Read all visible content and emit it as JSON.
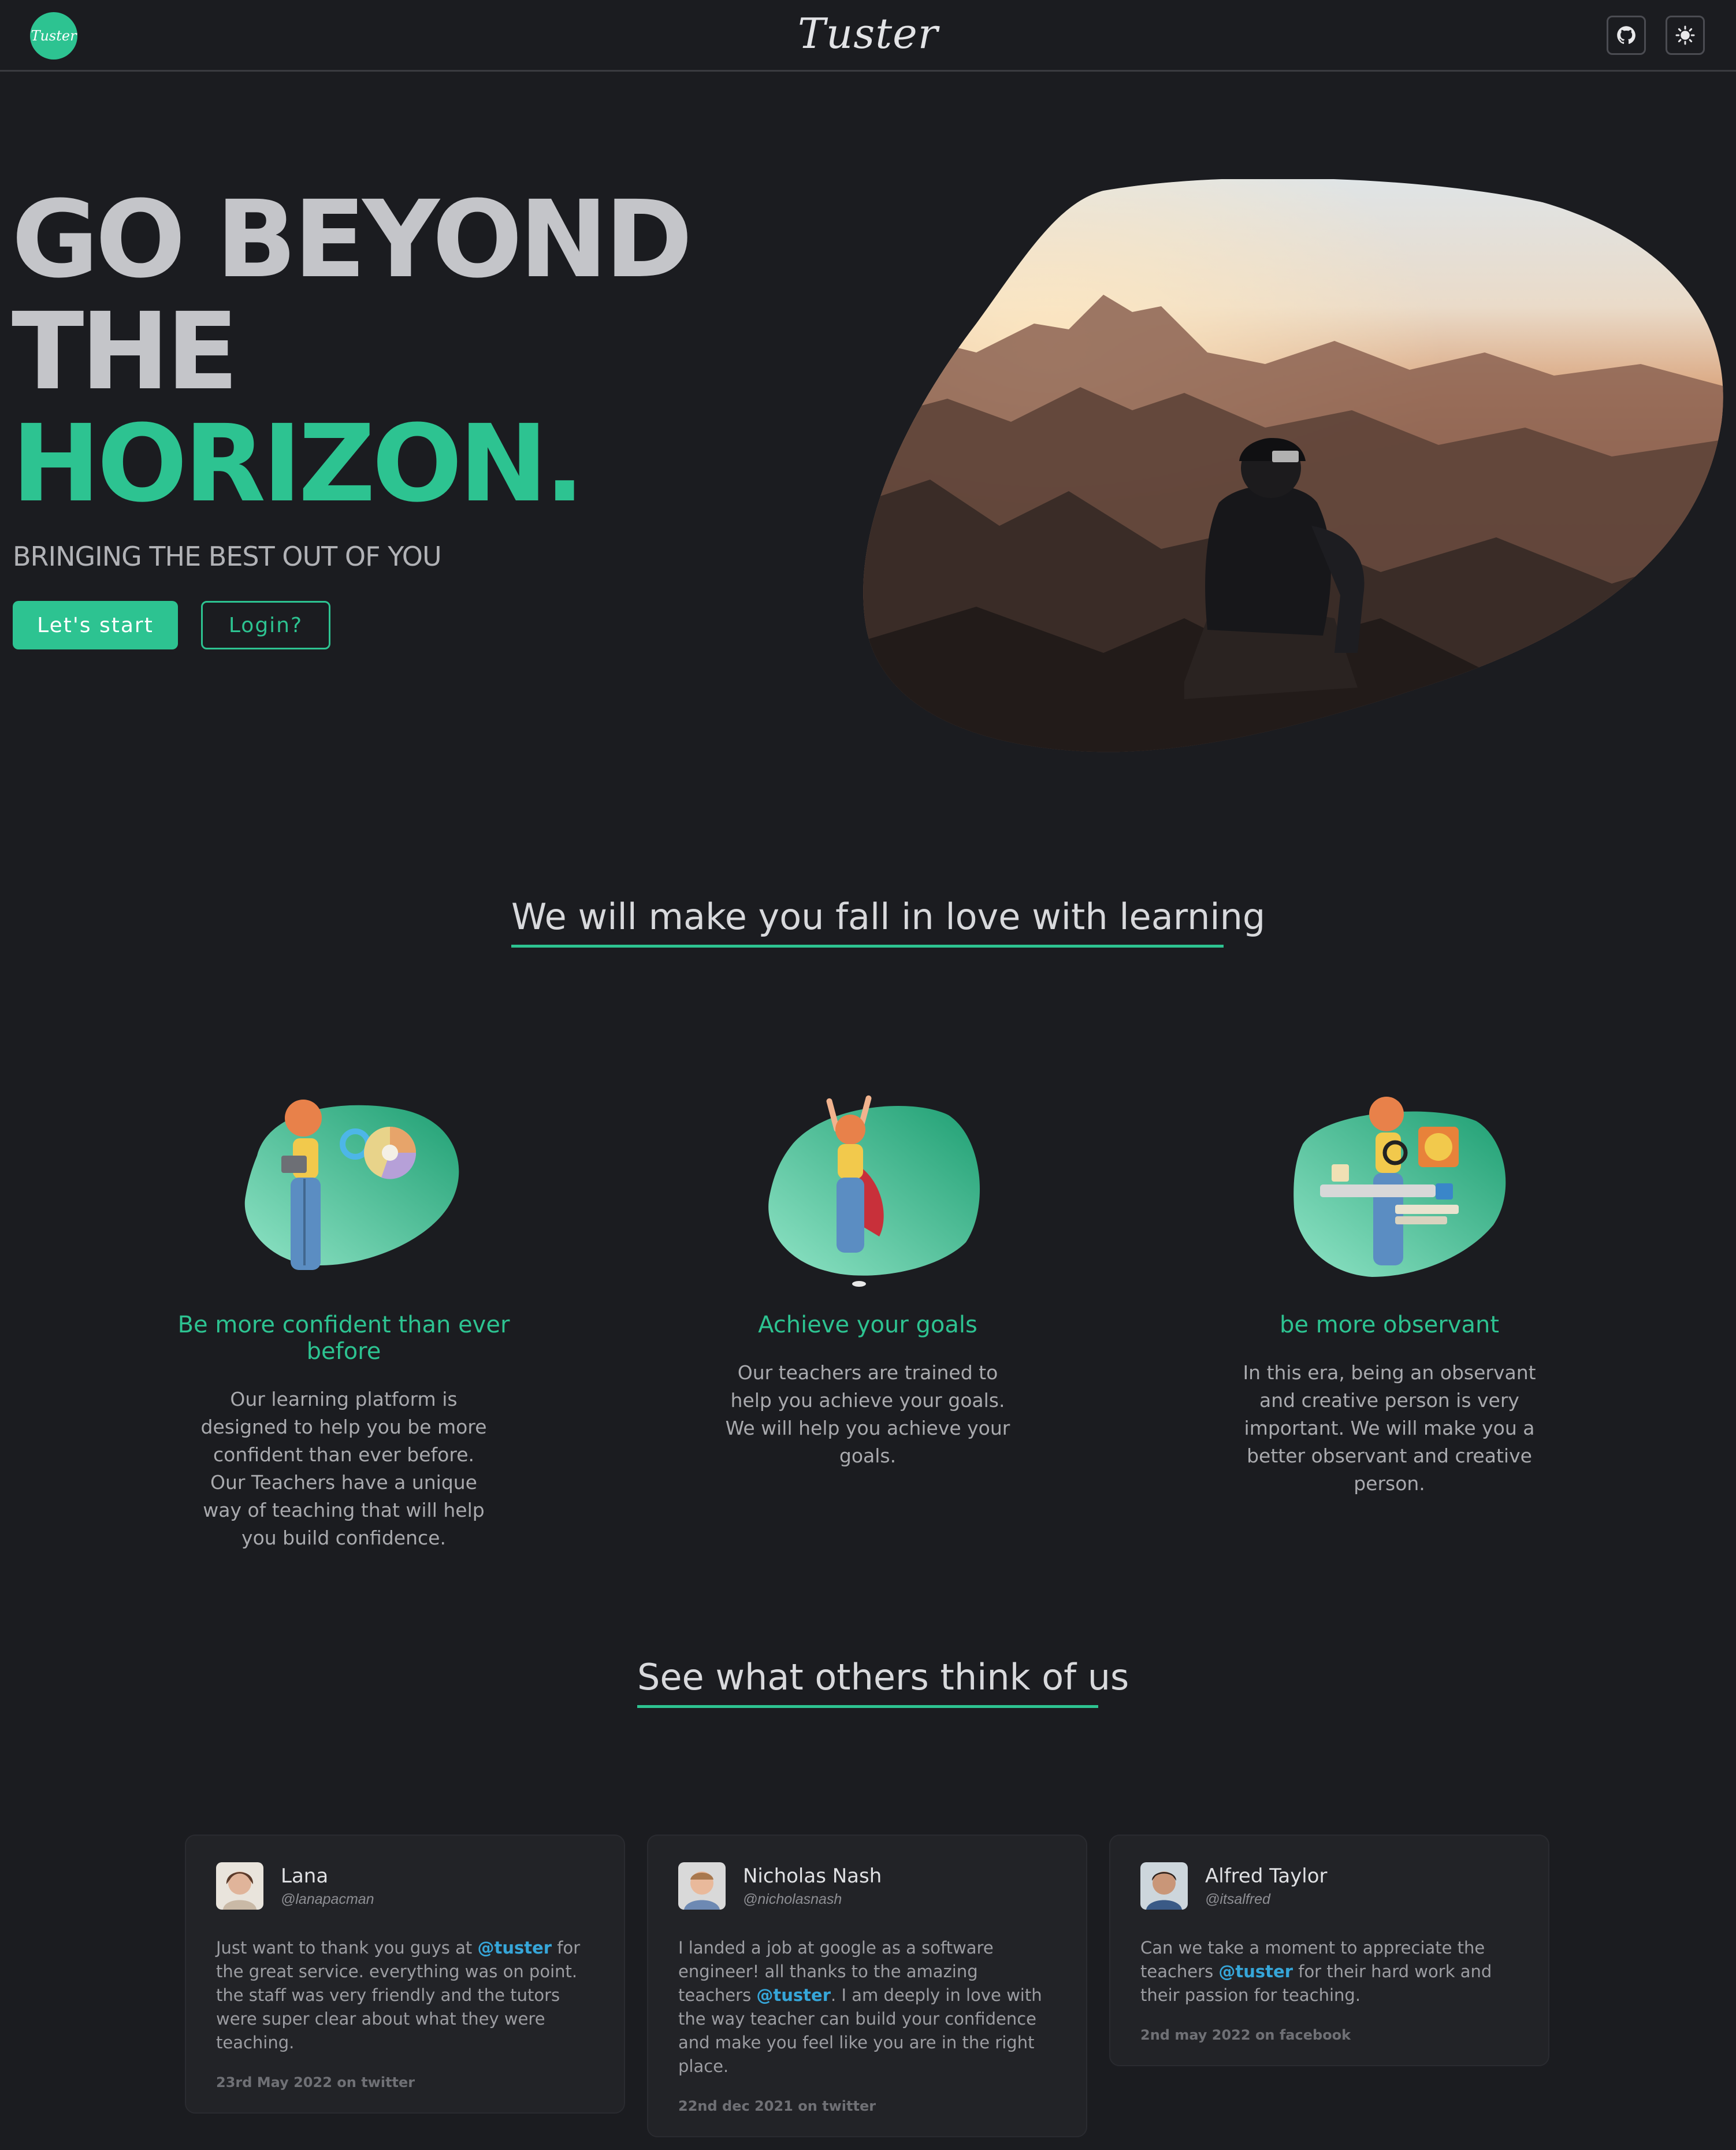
{
  "nav": {
    "logo_text": "Tuster",
    "title": "Tuster",
    "github_icon": "github-icon",
    "theme_icon": "sun-icon"
  },
  "hero": {
    "line1": "GO BEYOND",
    "line2": "THE",
    "line3": "HORIZON.",
    "subtitle": "BRINGING THE BEST OUT OF YOU",
    "primary_button": "Let's start",
    "secondary_button": "Login?"
  },
  "colors": {
    "background": "#1b1c20",
    "accent": "#2dc391",
    "mention": "#36a6d9",
    "card": "#222327"
  },
  "features": {
    "heading": "We will make you fall in love with learning",
    "items": [
      {
        "title": "Be more confident than ever before",
        "text": "Our learning platform is designed to help you be more confident than ever before. Our Teachers have a unique way of teaching that will help you build confidence."
      },
      {
        "title": "Achieve your goals",
        "text": "Our teachers are trained to help you achieve your goals. We will help you achieve your goals."
      },
      {
        "title": "be more observant",
        "text": "In this era, being an observant and creative person is very important. We will make you a better observant and creative person."
      }
    ]
  },
  "testimonials": {
    "heading": "See what others think of us",
    "items": [
      {
        "name": "Lana",
        "handle": "@lanapacman",
        "text_before": "Just want to thank you guys at ",
        "mention": "@tuster",
        "text_after": " for the great service. everything was on point. the staff was very friendly and the tutors were super clear about what they were teaching.",
        "date": "23rd May 2022 on twitter"
      },
      {
        "name": "Nicholas Nash",
        "handle": "@nicholasnash",
        "text_before": "I landed a job at google as a software engineer! all thanks to the amazing teachers ",
        "mention": "@tuster",
        "text_after": ". I am deeply in love with the way teacher can build your confidence and make you feel like you are in the right place.",
        "date": "22nd dec 2021 on twitter"
      },
      {
        "name": "Alfred Taylor",
        "handle": "@itsalfred",
        "text_before": "Can we take a moment to appreciate the teachers ",
        "mention": "@tuster",
        "text_after": " for their hard work and their passion for teaching.",
        "date": "2nd may 2022 on facebook"
      }
    ]
  }
}
